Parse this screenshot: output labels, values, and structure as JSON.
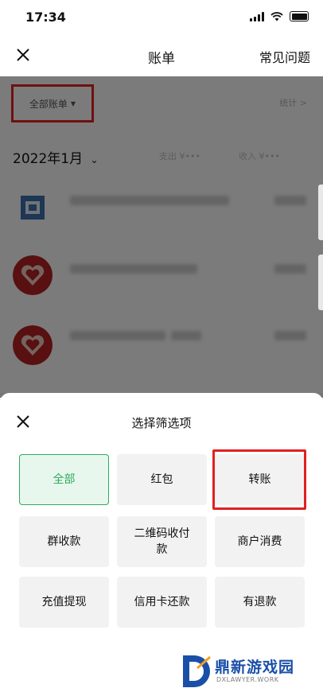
{
  "status": {
    "time": "17:34"
  },
  "nav": {
    "title": "账单",
    "faq": "常见问题"
  },
  "filter": {
    "label": "全部账单",
    "stats_label": "统计"
  },
  "month": {
    "label": "2022年1月",
    "expense_label": "支出",
    "income_label": "收入"
  },
  "sheet": {
    "title": "选择筛选项",
    "options": [
      "全部",
      "红包",
      "转账",
      "群收款",
      "二维码收付款",
      "商户消费",
      "充值提现",
      "信用卡还款",
      "有退款"
    ],
    "selected": "全部"
  },
  "watermark": {
    "name": "鼎新游戏园",
    "site": "DXLAWYER.WORK"
  },
  "colors": {
    "accent_green": "#2faa5c",
    "highlight_red": "#e02020",
    "brand_blue": "#1a4fa8"
  }
}
